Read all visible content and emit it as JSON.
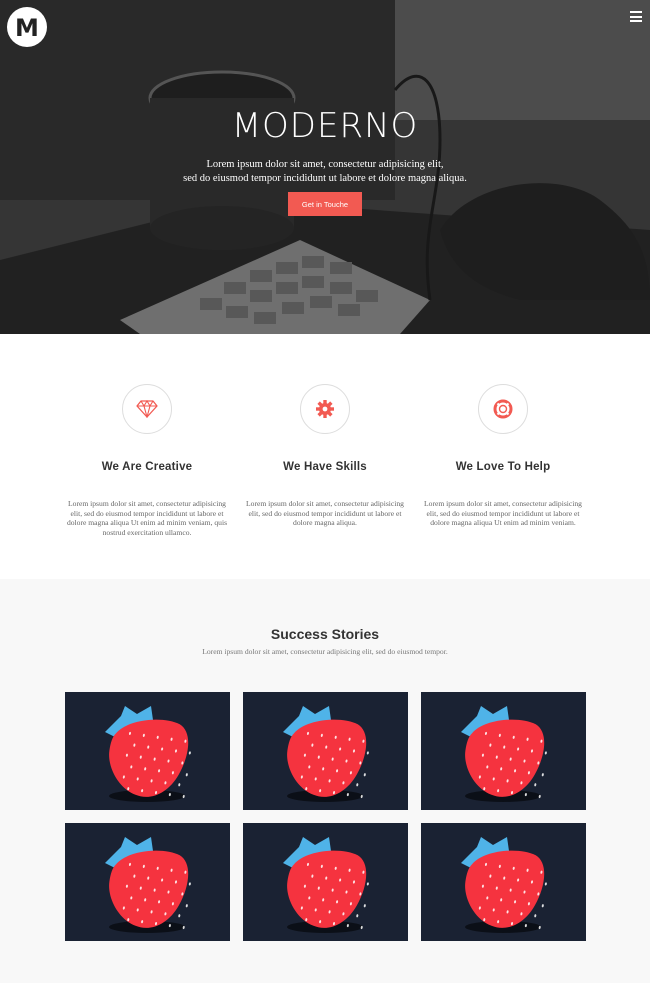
{
  "header": {
    "logo_letter": "M",
    "logo_icon": "logo-m-icon",
    "menu_icon": "hamburger-menu-icon"
  },
  "hero": {
    "title": "MODERNO",
    "subtitle_line1": "Lorem ipsum dolor sit amet, consectetur adipisicing elit,",
    "subtitle_line2": "sed do eiusmod tempor incididunt ut labore et dolore magna aliqua.",
    "cta_label": "Get in Touche",
    "cta_color": "#f25a52"
  },
  "features": [
    {
      "icon": "diamond-icon",
      "title": "We Are Creative",
      "text": "Lorem ipsum dolor sit amet, consectetur adipisicing elit, sed do eiusmod tempor incididunt ut labore et dolore magna aliqua Ut enim ad minim veniam, quis nostrud exercitation ullamco."
    },
    {
      "icon": "gear-icon",
      "title": "We Have Skills",
      "text": "Lorem ipsum dolor sit amet, consectetur adipisicing elit, sed do eiusmod tempor incididunt ut labore et dolore magna aliqua."
    },
    {
      "icon": "lifebuoy-icon",
      "title": "We Love To Help",
      "text": "Lorem ipsum dolor sit amet, consectetur adipisicing elit, sed do eiusmod tempor incididunt ut labore et dolore magna aliqua Ut enim ad minim veniam."
    }
  ],
  "stories": {
    "title": "Success Stories",
    "subtitle": "Lorem ipsum dolor sit amet, consectetur adipisicing elit, sed do eiusmod tempor.",
    "tile_image": "strawberry-illustration",
    "tile_count": 6
  },
  "colors": {
    "accent": "#f25a52",
    "tile_background": "#1a2233",
    "strawberry": "#f5333f",
    "leaf": "#4fb3e8"
  }
}
